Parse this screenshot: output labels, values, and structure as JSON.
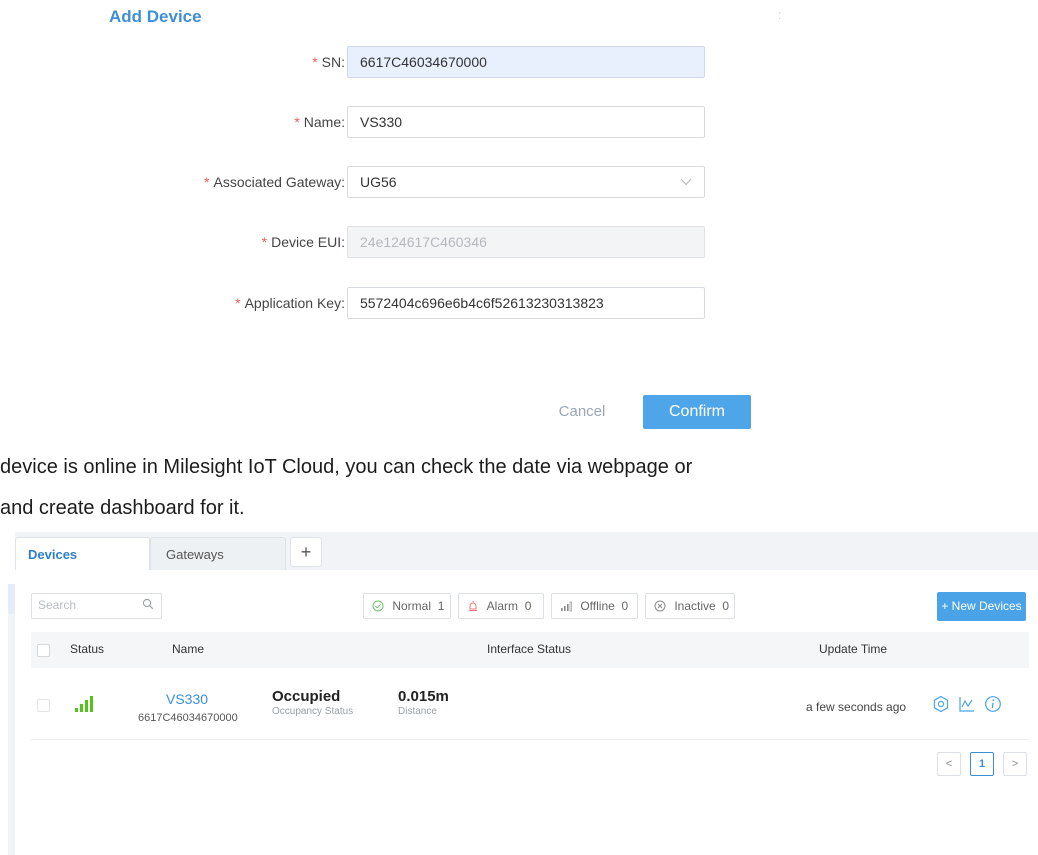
{
  "dialog": {
    "title": "Add Device",
    "dot": ":",
    "fields": {
      "sn": {
        "label": "SN:",
        "value": "6617C46034670000"
      },
      "name": {
        "label": "Name:",
        "value": "VS330"
      },
      "gateway": {
        "label": "Associated Gateway:",
        "value": "UG56"
      },
      "eui": {
        "label": "Device EUI:",
        "value": "24e124617C460346"
      },
      "appkey": {
        "label": "Application Key:",
        "value": "5572404c696e6b4c6f52613230313823"
      }
    },
    "required_mark": "*",
    "cancel": "Cancel",
    "confirm": "Confirm"
  },
  "doc": {
    "line1": "device is online in Milesight IoT Cloud, you can check the date via webpage or",
    "line2": "and create dashboard for it."
  },
  "app": {
    "tabs": {
      "devices": "Devices",
      "gateways": "Gateways",
      "add": "+"
    },
    "search": {
      "placeholder": "Search"
    },
    "filters": {
      "normal": {
        "label": "Normal",
        "count": "1"
      },
      "alarm": {
        "label": "Alarm",
        "count": "0"
      },
      "offline": {
        "label": "Offline",
        "count": "0"
      },
      "inactive": {
        "label": "Inactive",
        "count": "0"
      }
    },
    "new_button": "+ New Devices",
    "columns": {
      "status": "Status",
      "name": "Name",
      "interface": "Interface Status",
      "update": "Update Time"
    },
    "row": {
      "name": "VS330",
      "sn": "6617C46034670000",
      "occupancy_value": "Occupied",
      "occupancy_label": "Occupancy Status",
      "distance_value": "0.015m",
      "distance_label": "Distance",
      "update_time": "a few seconds ago"
    },
    "pagination": {
      "prev": "<",
      "current": "1",
      "next": ">"
    },
    "colors": {
      "accent": "#3a8fd8",
      "signal": "#52c41a",
      "required": "#ef5a5a"
    }
  }
}
